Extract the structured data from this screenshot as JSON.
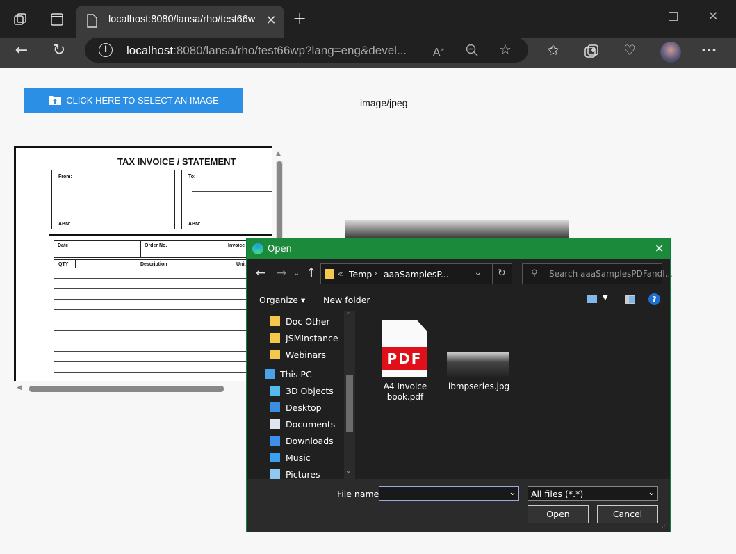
{
  "browser": {
    "tab_title": "localhost:8080/lansa/rho/test66w",
    "url_host": "localhost",
    "url_rest": ":8080/lansa/rho/test66wp?lang=eng&devel...",
    "icons": [
      "tab-actions-icon",
      "vertical-tabs-icon",
      "page-icon",
      "close-icon",
      "new-tab-icon",
      "back-icon",
      "refresh-icon",
      "info-icon",
      "read-aloud-icon",
      "zoom-icon",
      "favorite-icon",
      "favorites-icon",
      "collections-icon",
      "health-icon",
      "profile-icon",
      "more-icon",
      "minimize-icon",
      "maximize-icon",
      "window-close-icon"
    ]
  },
  "page": {
    "select_button": "CLICK HERE TO SELECT AN IMAGE",
    "mime_type": "image/jpeg",
    "invoice": {
      "title": "TAX INVOICE / STATEMENT",
      "from": "From:",
      "to": "To:",
      "abn": "ABN:",
      "date": "Date",
      "order_no": "Order No.",
      "invoice": "Invoice",
      "qty": "QTY",
      "description": "Description",
      "unit": "Unit"
    }
  },
  "dialog": {
    "title": "Open",
    "address": {
      "crumb1": "Temp",
      "crumb2": "aaaSamplesP...",
      "prefix": "«"
    },
    "search_placeholder": "Search aaaSamplesPDFandI...",
    "organize": "Organize",
    "new_folder": "New folder",
    "nav_items": [
      {
        "label": "Doc Other",
        "icon": "folder-icon"
      },
      {
        "label": "JSMInstance",
        "icon": "folder-icon"
      },
      {
        "label": "Webinars",
        "icon": "folder-icon"
      },
      {
        "label": "This PC",
        "icon": "computer-icon"
      },
      {
        "label": "3D Objects",
        "icon": "cube-icon"
      },
      {
        "label": "Desktop",
        "icon": "desktop-icon"
      },
      {
        "label": "Documents",
        "icon": "document-icon"
      },
      {
        "label": "Downloads",
        "icon": "download-icon"
      },
      {
        "label": "Music",
        "icon": "music-icon"
      },
      {
        "label": "Pictures",
        "icon": "picture-icon"
      }
    ],
    "files": [
      {
        "name_line1": "A4 Invoice",
        "name_line2": "book.pdf",
        "icon_text": "PDF"
      },
      {
        "name_line1": "ibmpseries.jpg",
        "name_line2": ""
      }
    ],
    "file_name_label": "File name:",
    "file_name_value": "",
    "file_type": "All files (*.*)",
    "open_button": "Open",
    "cancel_button": "Cancel"
  },
  "colors": {
    "accent": "#2b8fe6",
    "dialog_title": "#1b8b3b",
    "pdf_red": "#e0101a"
  }
}
